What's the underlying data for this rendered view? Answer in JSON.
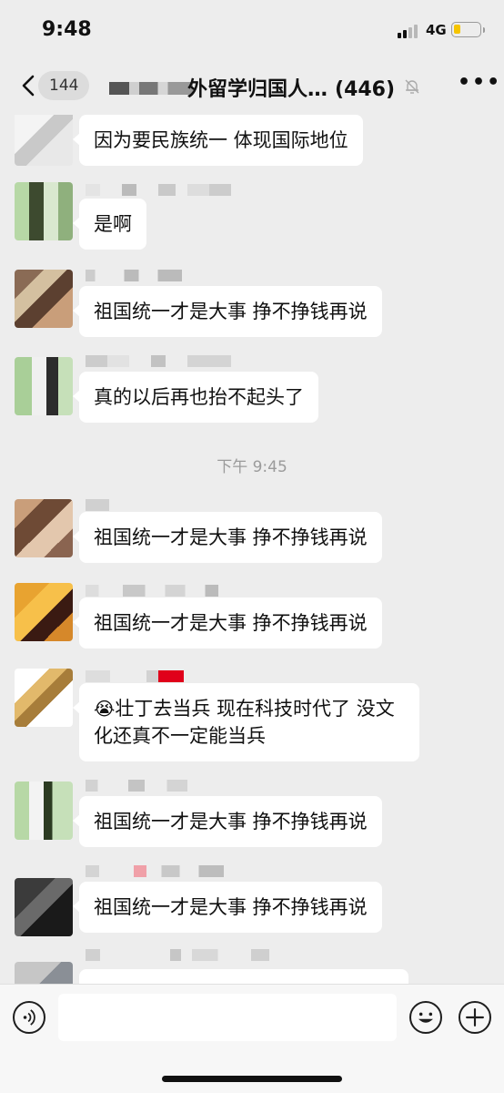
{
  "status_bar": {
    "time": "9:48",
    "network": "4G",
    "battery_color": "#f5c400"
  },
  "nav": {
    "unread_count": "144",
    "title": "外留学归国人…",
    "member_count": "(446)",
    "icons": [
      "chevron-left-icon",
      "mute-bell-icon",
      "more-dots-icon"
    ]
  },
  "chat": {
    "messages": [
      {
        "text": "因为要民族统一 体现国际地位"
      },
      {
        "text": "是啊"
      },
      {
        "text": "祖国统一才是大事 挣不挣钱再说"
      },
      {
        "text": "真的以后再也抬不起头了"
      },
      {
        "text": "祖国统一才是大事 挣不挣钱再说"
      },
      {
        "text": "祖国统一才是大事 挣不挣钱再说"
      },
      {
        "emoji": "😭",
        "text": "壮丁去当兵 现在科技时代了 没文化还真不一定能当兵"
      },
      {
        "text": "祖国统一才是大事 挣不挣钱再说"
      },
      {
        "text": "祖国统一才是大事 挣不挣钱再说"
      }
    ],
    "timestamp": "下午 9:45"
  },
  "input_bar": {
    "placeholder": "",
    "icons": [
      "voice-icon",
      "emoji-icon",
      "plus-icon"
    ]
  },
  "colors": {
    "background": "#ededed",
    "bubble": "#ffffff",
    "timestamp_text": "#9b9b9b"
  }
}
